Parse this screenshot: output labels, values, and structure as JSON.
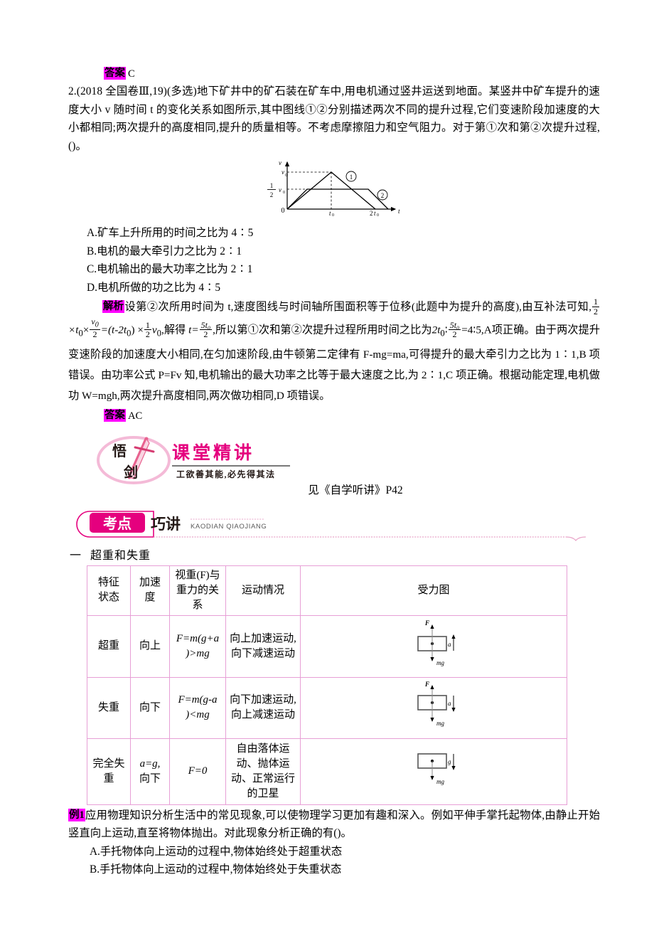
{
  "colors": {
    "tag_bg": "#ff00ff",
    "table_border": "#e79fd6",
    "banner_pink": "#e5007e",
    "banner_dark": "#231815",
    "logo_pink": "#ec4c9c"
  },
  "answer1": {
    "tag": "答案",
    "value": "C"
  },
  "question2": {
    "text": "2.(2018 全国卷Ⅲ,19)(多选)地下矿井中的矿石装在矿车中,用电机通过竖井运送到地面。某竖井中矿车提升的速度大小 v 随时间 t 的变化关系如图所示,其中图线①②分别描述两次不同的提升过程,它们变速阶段加速度的大小都相同;两次提升的高度相同,提升的质量相等。不考虑摩擦阻力和空气阻力。对于第①次和第②次提升过程,()。",
    "options": [
      "A.矿车上升所用的时间之比为 4∶5",
      "B.电机的最大牵引力之比为 2∶1",
      "C.电机输出的最大功率之比为 2∶1",
      "D.电机所做的功之比为 4∶5"
    ]
  },
  "chart_data": {
    "type": "line",
    "title": "",
    "xlabel": "t",
    "ylabel": "v",
    "axis_origin_label": "0",
    "y_ticks": [
      "v₀",
      "½v₀"
    ],
    "x_ticks": [
      "t₀",
      "2t₀"
    ],
    "series": [
      {
        "name": "①",
        "label": "①",
        "points": [
          [
            0,
            0
          ],
          [
            1,
            1
          ],
          [
            2,
            0
          ]
        ],
        "description": "triangle: rises from 0 to v0 at t0, falls back to 0 at 2t0"
      },
      {
        "name": "②",
        "label": "②",
        "points": [
          [
            0,
            0
          ],
          [
            0.5,
            0.5
          ],
          [
            2.25,
            0.5
          ],
          [
            2.75,
            0
          ]
        ],
        "description": "trapezoid: rises to v0/2, constant, then falls to 0"
      }
    ]
  },
  "analysis": {
    "tag": "解析",
    "part1": "设第②次所用时间为 t,速度图线与时间轴所围面积等于位移(此题中为提升的高度),由互补法可知,",
    "eq1_left_frac_num": "1",
    "eq1_left_frac_den": "2",
    "eq1_mid": "×t",
    "eq1_sub": "0",
    "eq1_times": "×",
    "eq1_v_frac_num": "v",
    "eq1_v_frac_vsub": "0",
    "eq1_v_frac_den": "2",
    "eq1_eq": "=(t-2t",
    "eq1_t0sub": "0",
    "eq1_close": ") ×",
    "eq2_frac_num": "1",
    "eq2_frac_den": "2",
    "eq2_v": "v",
    "eq2_vsub": "0",
    "eq2_comma": ",解得 ",
    "eq3_t": "t=",
    "eq3_num": "5t₀",
    "eq3_den": "2",
    "part2": ",所以第①次和第②次提升过程所用时间之比为",
    "ratio_left": "2t",
    "ratio_left_sub": "0",
    "ratio_colon": "∶",
    "ratio_frac_num": "5t₀",
    "ratio_frac_den": "2",
    "ratio_eq": "=4∶5,",
    "part3": "A项正确。由于两次提升变速阶段的加速度大小相同,在匀加速阶段,由牛顿第二定律有 F-mg=ma,可得提升的最大牵引力之比为 1∶1,B 项错误。由功率公式 P=Fv 知,电机输出的最大功率之比等于最大速度之比,为 2∶1,C 项正确。根据动能定理,电机做功 W=mgh,两次提升高度相同,两次做功相同,D 项错误。"
  },
  "answer2": {
    "tag": "答案",
    "value": "AC"
  },
  "logo": {
    "char_top": "悟",
    "char_bottom": "剑",
    "title": "课堂精讲",
    "subtitle": "工欲善其能,必先得其法",
    "see_text": "见《自学听讲》P42"
  },
  "banner": {
    "label_left": "考点",
    "label_right": "巧讲",
    "pinyin": "KAODIAN QIAOJIANG"
  },
  "section": {
    "number": "一",
    "title": "超重和失重"
  },
  "table": {
    "headers": [
      "特征状态",
      "加速度",
      "视重(F)与重力的关系",
      "运动情况",
      "受力图"
    ],
    "header_cells": {
      "h1_line1": "特征",
      "h1_line2": "状态",
      "h2_line1": "加速",
      "h2_line2": "度",
      "h3_line1": "视重(F)与",
      "h3_line2": "重力的关",
      "h3_line3": "系",
      "h4": "运动情况",
      "h5": "受力图"
    },
    "rows": [
      {
        "state": "超重",
        "accel": "向上",
        "formula_a": "F=m(g+a",
        "formula_b": ")>mg",
        "motion": "向上加速运动,向下减速运动",
        "diagram": {
          "top_label": "F",
          "bottom_label": "mg",
          "side_label": "a",
          "side_dir": "up",
          "has_top_arrow": true
        }
      },
      {
        "state": "失重",
        "accel": "向下",
        "formula_a": "F=m(g-a",
        "formula_b": ")<mg",
        "motion": "向下加速运动,向上减速运动",
        "diagram": {
          "top_label": "F",
          "bottom_label": "mg",
          "side_label": "a",
          "side_dir": "down",
          "has_top_arrow": true
        }
      },
      {
        "state": "完全失重",
        "accel_a": "a=g,",
        "accel_b": "向下",
        "formula_a": "F=0",
        "formula_b": "",
        "motion": "自由落体运动、抛体运动、正常运行的卫星",
        "diagram": {
          "top_label": "",
          "bottom_label": "mg",
          "side_label": "g",
          "side_dir": "down",
          "has_top_arrow": false
        }
      }
    ]
  },
  "example1": {
    "tag": "例1",
    "body": "应用物理知识分析生活中的常见现象,可以使物理学习更加有趣和深入。例如平伸手掌托起物体,由静止开始竖直向上运动,直至将物体抛出。对此现象分析正确的有()。",
    "options": [
      "A.手托物体向上运动的过程中,物体始终处于超重状态",
      "B.手托物体向上运动的过程中,物体始终处于失重状态"
    ]
  }
}
